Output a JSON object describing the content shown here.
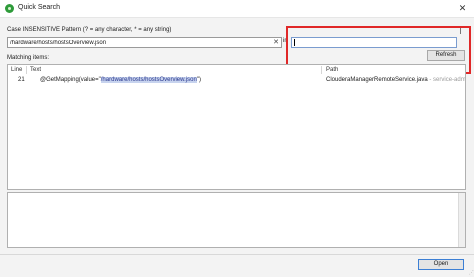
{
  "window": {
    "title": "Quick Search",
    "close_glyph": "✕"
  },
  "search": {
    "pattern_label": "Case INSENSITIVE Pattern (? = any character, * = any string)",
    "pattern_value": "/hardware/hosts/hostsOverview.json",
    "clear_glyph": "✕",
    "in_label": "in",
    "in_value": ""
  },
  "results": {
    "matching_label": "Matching items:",
    "refresh_label": "Refresh",
    "columns": [
      "Line",
      "Text",
      "Path"
    ],
    "rows": [
      {
        "line": "21",
        "text_prefix": "@GetMapping(value=\"",
        "text_match": "/hardware/hosts/hostsOverview.json",
        "text_suffix": "\")",
        "path": "ClouderaManagerRemoteService.java",
        "path_suffix": "- service-adm"
      }
    ]
  },
  "footer": {
    "open_label": "Open"
  },
  "colors": {
    "highlight_box": "#e02828",
    "match_bg": "#c7d3ee",
    "app_icon": "#2e9b3a"
  },
  "icons": {
    "app": "eclipse-logo-icon",
    "close": "close-icon",
    "clear": "clear-icon",
    "resize": "resize-grip-icon"
  }
}
